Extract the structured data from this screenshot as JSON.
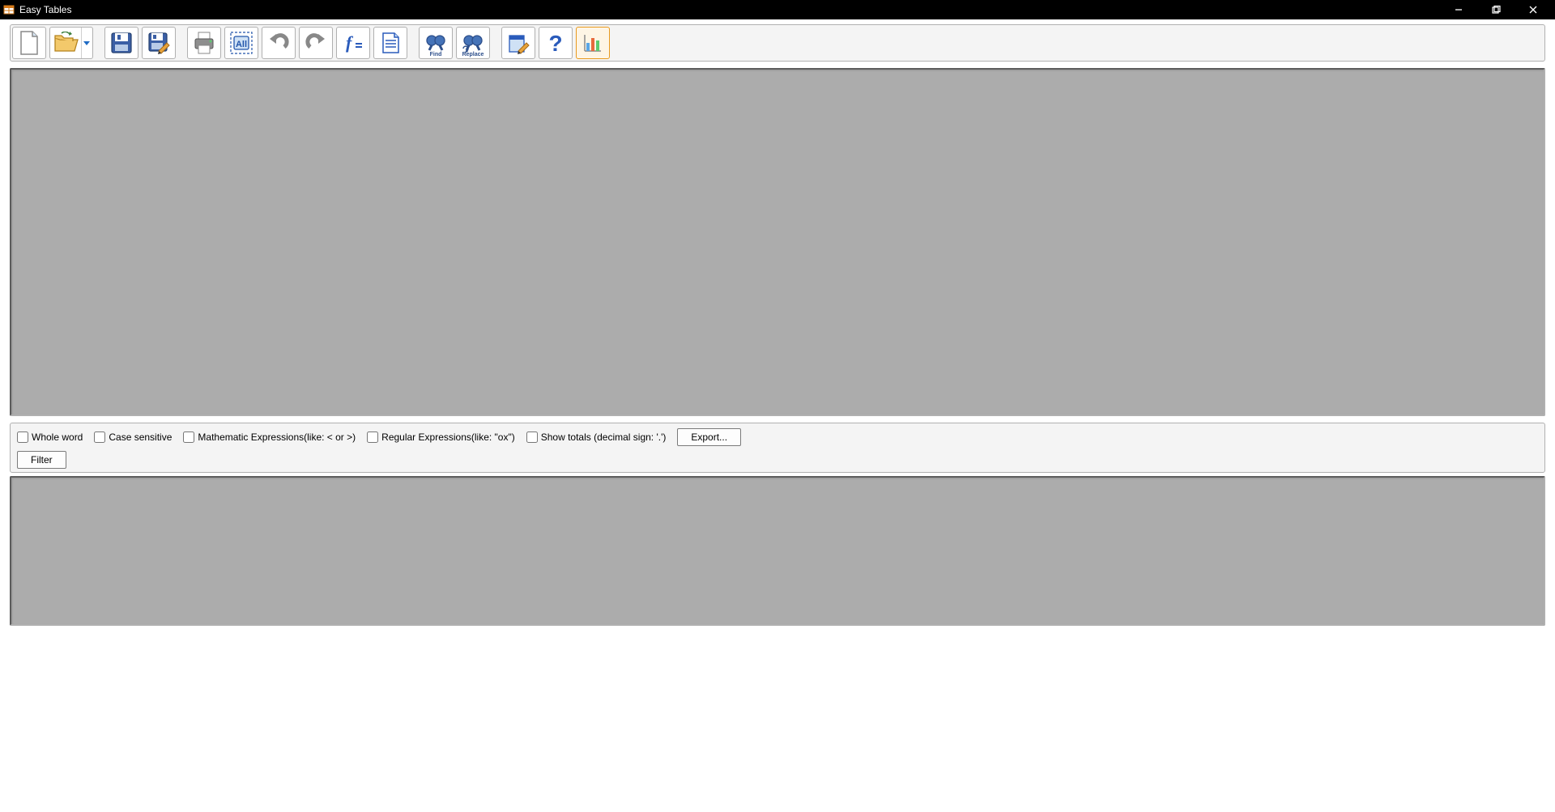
{
  "window": {
    "title": "Easy Tables"
  },
  "toolbar": {
    "find_label": "Find",
    "replace_label": "Replace"
  },
  "filter": {
    "whole_word": "Whole word",
    "case_sensitive": "Case sensitive",
    "math_expr": "Mathematic Expressions(like: < or >)",
    "regex": "Regular Expressions(like: \"ox\")",
    "show_totals": "Show totals (decimal sign: '.')",
    "export_btn": "Export...",
    "filter_btn": "Filter"
  }
}
